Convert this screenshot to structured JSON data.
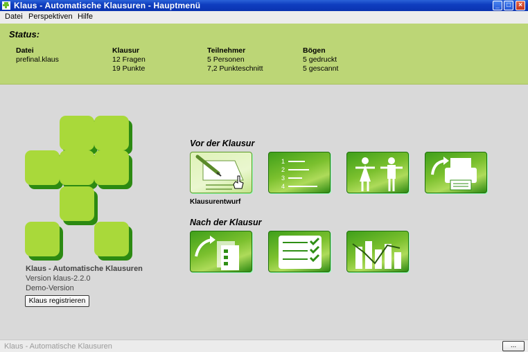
{
  "window": {
    "title": "Klaus - Automatische Klausuren - Hauptmenü"
  },
  "menu": {
    "items": [
      "Datei",
      "Perspektiven",
      "Hilfe"
    ]
  },
  "status": {
    "heading": "Status:",
    "columns": [
      {
        "header": "Datei",
        "lines": [
          "prefinal.klaus"
        ]
      },
      {
        "header": "Klausur",
        "lines": [
          "12 Fragen",
          "19 Punkte"
        ]
      },
      {
        "header": "Teilnehmer",
        "lines": [
          "5 Personen",
          "7,2 Punkteschnitt"
        ]
      },
      {
        "header": "Bögen",
        "lines": [
          "5 gedruckt",
          "5 gescannt"
        ]
      }
    ]
  },
  "info": {
    "app_name": "Klaus - Automatische Klausuren",
    "version": "Version klaus-2.2.0",
    "edition": "Demo-Version",
    "register_label": "Klaus registrieren"
  },
  "sections": {
    "before": "Vor der Klausur",
    "after": "Nach der Klausur",
    "active_tile_label": "Klausurentwurf",
    "question_numbers": [
      "1",
      "2",
      "3",
      "4"
    ]
  },
  "statusbar": {
    "text": "Klaus - Automatische Klausuren",
    "button": "..."
  },
  "colors": {
    "green": "#2f8f14",
    "light_green": "#a9d93a",
    "status_bg": "#bcd676",
    "title_blue": "#0f3ec0"
  }
}
